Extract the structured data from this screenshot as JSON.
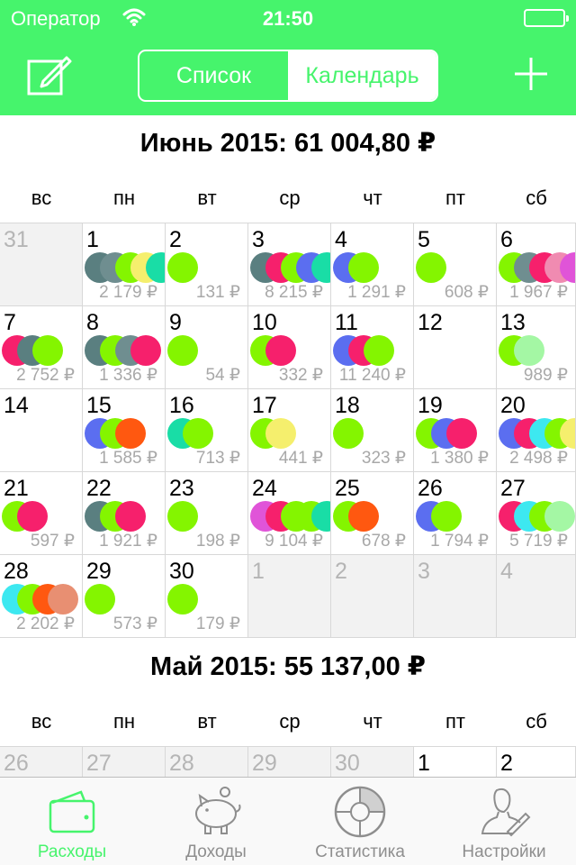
{
  "status_bar": {
    "carrier": "Оператор",
    "time": "21:50"
  },
  "nav": {
    "edit_icon": "compose-icon",
    "add_icon": "plus-icon",
    "segments": [
      "Список",
      "Календарь"
    ],
    "selected_segment": "Календарь"
  },
  "colors": {
    "accent": "#46f46c",
    "dot_palette": [
      "#5a7f80",
      "#6f8e90",
      "#84f500",
      "#f5ef6d",
      "#19dda6",
      "#5b6ef0",
      "#f6206c",
      "#f08bb1",
      "#e054d8",
      "#ff5810",
      "#3de8f0",
      "#a4f7a4",
      "#e88f72"
    ]
  },
  "months": [
    {
      "title": "Июнь 2015: 61 004,80 ₽",
      "weekdays": [
        "вс",
        "пн",
        "вт",
        "ср",
        "чт",
        "пт",
        "сб"
      ],
      "weeks": [
        [
          {
            "day": "31",
            "other": true
          },
          {
            "day": "1",
            "amount": "2 179 ₽",
            "dots": [
              "#5a7f80",
              "#6f8e90",
              "#84f500",
              "#f5ef6d",
              "#19dda6"
            ]
          },
          {
            "day": "2",
            "amount": "131 ₽",
            "dots": [
              "#84f500"
            ]
          },
          {
            "day": "3",
            "amount": "8 215 ₽",
            "dots": [
              "#5a7f80",
              "#f6206c",
              "#84f500",
              "#5b6ef0",
              "#19dda6"
            ]
          },
          {
            "day": "4",
            "amount": "1 291 ₽",
            "dots": [
              "#5b6ef0",
              "#84f500"
            ]
          },
          {
            "day": "5",
            "amount": "608 ₽",
            "dots": [
              "#84f500"
            ]
          },
          {
            "day": "6",
            "amount": "1 967 ₽",
            "dots": [
              "#84f500",
              "#6f8e90",
              "#f6206c",
              "#f08bb1",
              "#e054d8"
            ]
          }
        ],
        [
          {
            "day": "7",
            "amount": "2 752 ₽",
            "dots": [
              "#f6206c",
              "#5a7f80",
              "#84f500"
            ]
          },
          {
            "day": "8",
            "amount": "1 336 ₽",
            "dots": [
              "#5a7f80",
              "#84f500",
              "#6f8e90",
              "#f6206c"
            ]
          },
          {
            "day": "9",
            "amount": "54 ₽",
            "dots": [
              "#84f500"
            ]
          },
          {
            "day": "10",
            "amount": "332 ₽",
            "dots": [
              "#84f500",
              "#f6206c"
            ]
          },
          {
            "day": "11",
            "amount": "11 240 ₽",
            "dots": [
              "#5b6ef0",
              "#f6206c",
              "#84f500"
            ]
          },
          {
            "day": "12"
          },
          {
            "day": "13",
            "amount": "989 ₽",
            "dots": [
              "#84f500",
              "#a4f7a4"
            ]
          }
        ],
        [
          {
            "day": "14"
          },
          {
            "day": "15",
            "amount": "1 585 ₽",
            "dots": [
              "#5b6ef0",
              "#84f500",
              "#ff5810"
            ]
          },
          {
            "day": "16",
            "amount": "713 ₽",
            "dots": [
              "#19dda6",
              "#84f500"
            ]
          },
          {
            "day": "17",
            "amount": "441 ₽",
            "dots": [
              "#84f500",
              "#f5ef6d"
            ]
          },
          {
            "day": "18",
            "amount": "323 ₽",
            "dots": [
              "#84f500"
            ]
          },
          {
            "day": "19",
            "amount": "1 380 ₽",
            "dots": [
              "#84f500",
              "#5b6ef0",
              "#f6206c"
            ]
          },
          {
            "day": "20",
            "amount": "2 498 ₽",
            "dots": [
              "#5b6ef0",
              "#f6206c",
              "#3de8f0",
              "#84f500",
              "#f5ef6d"
            ]
          }
        ],
        [
          {
            "day": "21",
            "amount": "597 ₽",
            "dots": [
              "#84f500",
              "#f6206c"
            ]
          },
          {
            "day": "22",
            "amount": "1 921 ₽",
            "dots": [
              "#5a7f80",
              "#84f500",
              "#f6206c"
            ]
          },
          {
            "day": "23",
            "amount": "198 ₽",
            "dots": [
              "#84f500"
            ]
          },
          {
            "day": "24",
            "amount": "9 104 ₽",
            "dots": [
              "#e054d8",
              "#f6206c",
              "#84f500",
              "#84f500",
              "#19dda6"
            ]
          },
          {
            "day": "25",
            "amount": "678 ₽",
            "dots": [
              "#84f500",
              "#ff5810"
            ]
          },
          {
            "day": "26",
            "amount": "1 794 ₽",
            "dots": [
              "#5b6ef0",
              "#84f500"
            ]
          },
          {
            "day": "27",
            "amount": "5 719 ₽",
            "dots": [
              "#f6206c",
              "#3de8f0",
              "#84f500",
              "#a4f7a4"
            ]
          }
        ],
        [
          {
            "day": "28",
            "amount": "2 202 ₽",
            "dots": [
              "#3de8f0",
              "#84f500",
              "#ff5810",
              "#e88f72"
            ]
          },
          {
            "day": "29",
            "amount": "573 ₽",
            "dots": [
              "#84f500"
            ]
          },
          {
            "day": "30",
            "amount": "179 ₽",
            "dots": [
              "#84f500"
            ]
          },
          {
            "day": "1",
            "other": true
          },
          {
            "day": "2",
            "other": true
          },
          {
            "day": "3",
            "other": true
          },
          {
            "day": "4",
            "other": true
          }
        ]
      ]
    },
    {
      "title": "Май 2015: 55 137,00 ₽",
      "weekdays": [
        "вс",
        "пн",
        "вт",
        "ср",
        "чт",
        "пт",
        "сб"
      ],
      "weeks": [
        [
          {
            "day": "26",
            "other": true
          },
          {
            "day": "27",
            "other": true
          },
          {
            "day": "28",
            "other": true
          },
          {
            "day": "29",
            "other": true
          },
          {
            "day": "30",
            "other": true
          },
          {
            "day": "1"
          },
          {
            "day": "2"
          }
        ]
      ]
    }
  ],
  "tabbar": {
    "tabs": [
      {
        "label": "Расходы",
        "icon": "wallet-icon",
        "active": true
      },
      {
        "label": "Доходы",
        "icon": "piggy-bank-icon",
        "active": false
      },
      {
        "label": "Статистика",
        "icon": "pie-chart-icon",
        "active": false
      },
      {
        "label": "Настройки",
        "icon": "user-settings-icon",
        "active": false
      }
    ]
  }
}
